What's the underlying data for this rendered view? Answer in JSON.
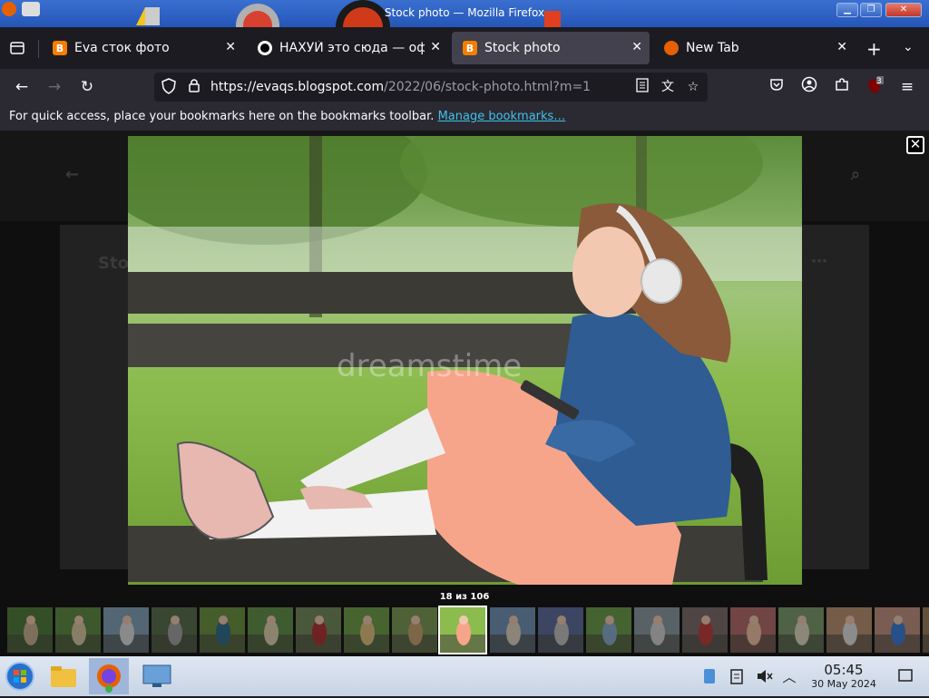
{
  "window": {
    "title": "Stock photo — Mozilla Firefox"
  },
  "tabs": [
    {
      "label": "Eva сток фото",
      "favicon": "blogger-icon",
      "active": false
    },
    {
      "label": "НАХУЙ это сюда — офи",
      "favicon": "site-icon",
      "active": false
    },
    {
      "label": "Stock photo",
      "favicon": "blogger-icon",
      "active": true
    },
    {
      "label": "New Tab",
      "favicon": "firefox-icon",
      "active": false
    }
  ],
  "navbar": {
    "url_host": "https://evaqs.blogspot.com",
    "url_path": "/2022/06/stock-photo.html?m=1",
    "extension_badge": "3"
  },
  "bookmarks_bar": {
    "message": "For quick access, place your bookmarks here on the bookmarks toolbar.",
    "link": "Manage bookmarks…"
  },
  "lightbox": {
    "counter": "18 из 106",
    "watermark": "dreamstime",
    "current_index": 18,
    "total": 106,
    "thumb_count": 20
  },
  "taskbar": {
    "time": "05:45",
    "date": "30 May 2024"
  },
  "colors": {
    "accent": "#3ec2e8",
    "titlebar": "#2456b8",
    "blogger": "#f57d00"
  }
}
